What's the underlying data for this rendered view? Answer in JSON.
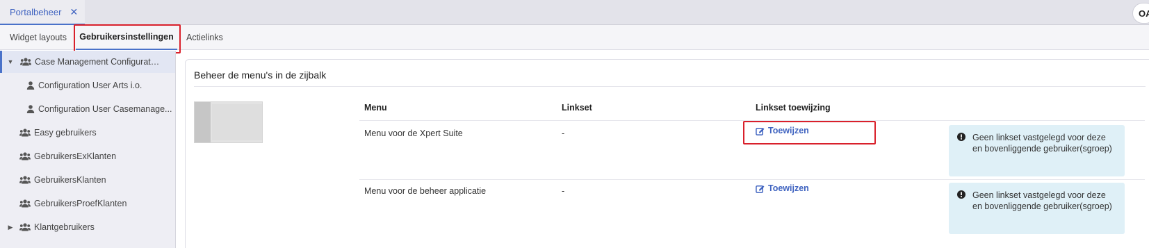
{
  "doc_tab": {
    "label": "Portalbeheer",
    "close": "✕"
  },
  "user_chip": {
    "initials": "OA"
  },
  "subtabs": [
    {
      "label": "Widget layouts"
    },
    {
      "label": "Gebruikersinstellingen"
    },
    {
      "label": "Actielinks"
    }
  ],
  "sidebar": {
    "items": [
      {
        "label": "Case Management Configuration ...",
        "type": "group",
        "expander": "expanded"
      },
      {
        "label": "Configuration User Arts i.o.",
        "type": "user"
      },
      {
        "label": "Configuration User Casemanage...",
        "type": "user"
      },
      {
        "label": "Easy gebruikers",
        "type": "group"
      },
      {
        "label": "GebruikersExKlanten",
        "type": "group"
      },
      {
        "label": "GebruikersKlanten",
        "type": "group"
      },
      {
        "label": "GebruikersProefKlanten",
        "type": "group"
      },
      {
        "label": "Klantgebruikers",
        "type": "group",
        "expander": "collapsed"
      }
    ]
  },
  "panel": {
    "title": "Beheer de menu's in de zijbalk",
    "table": {
      "headers": {
        "menu": "Menu",
        "linkset": "Linkset",
        "assignment": "Linkset toewijzing"
      },
      "rows": [
        {
          "menu": "Menu voor de Xpert Suite",
          "linkset": "-",
          "assign_label": "Toewijzen",
          "info": "Geen linkset vastgelegd voor deze en bovenliggende gebruiker(sgroep)"
        },
        {
          "menu": "Menu voor de beheer applicatie",
          "linkset": "-",
          "assign_label": "Toewijzen",
          "info": "Geen linkset vastgelegd voor deze en bovenliggende gebruiker(sgroep)"
        }
      ]
    }
  },
  "colors": {
    "accent": "#4a72c9",
    "link": "#3f63c0",
    "highlight": "#d9202b",
    "info_bg": "#dff0f7",
    "sidebar_bg": "#eeeef4"
  },
  "icons": {
    "group": "users-icon",
    "user": "user-icon",
    "assign": "edit-icon",
    "info": "exclamation-circle-icon",
    "close": "close-icon"
  }
}
